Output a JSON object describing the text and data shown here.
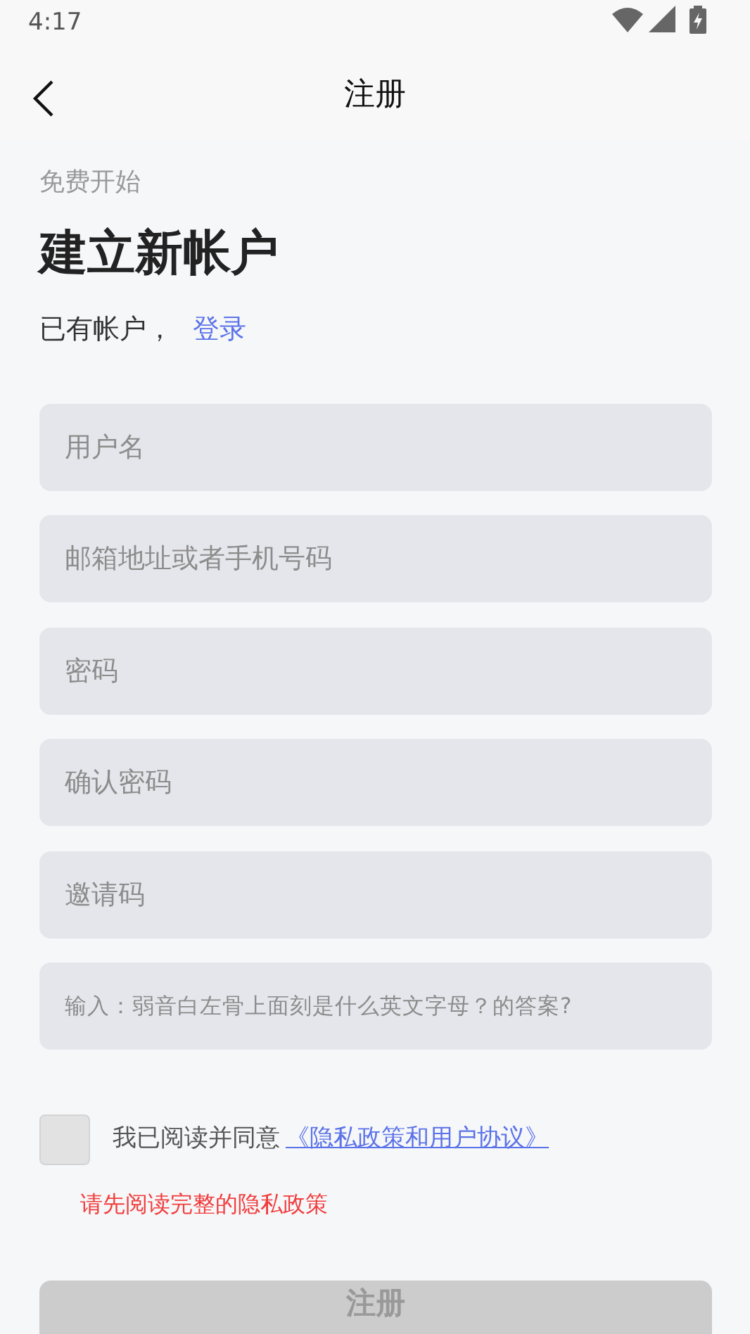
{
  "status_bar": {
    "time": "4:17"
  },
  "header": {
    "title": "注册"
  },
  "intro": {
    "subtitle": "免费开始",
    "heading": "建立新帐户",
    "have_account": "已有帐户，",
    "login_link": "登录"
  },
  "fields": [
    {
      "placeholder": "用户名"
    },
    {
      "placeholder": "邮箱地址或者手机号码"
    },
    {
      "placeholder": "密码",
      "kind": "password"
    },
    {
      "placeholder": "确认密码",
      "kind": "password"
    },
    {
      "placeholder": "邀请码"
    },
    {
      "placeholder": "输入：弱音白左骨上面刻是什么英文字母？的答案?",
      "kind": "question"
    }
  ],
  "agreement": {
    "checked": false,
    "text": "我已阅读并同意",
    "link": "《隐私政策和用户协议》",
    "error": "请先阅读完整的隐私政策"
  },
  "submit": {
    "label": "注册",
    "disabled": true
  }
}
